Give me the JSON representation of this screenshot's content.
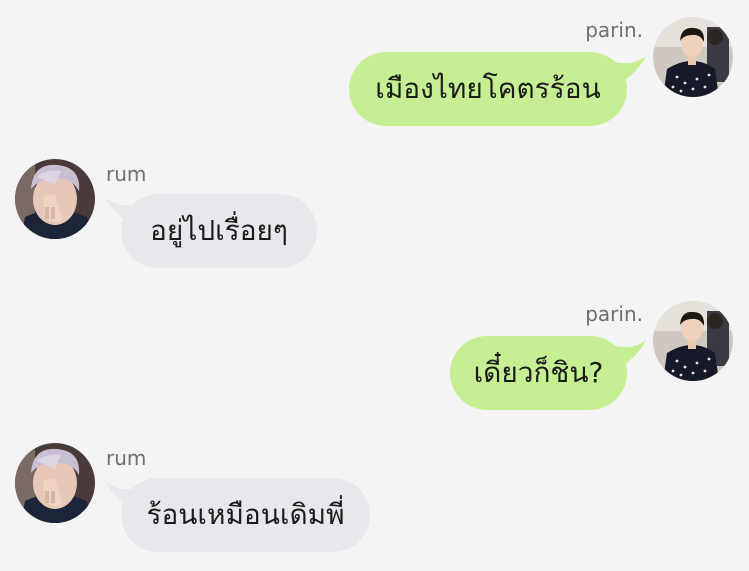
{
  "messages": [
    {
      "sender": "parin.",
      "side": "right",
      "text": "เมืองไทยโคตรร้อน"
    },
    {
      "sender": "rum",
      "side": "left",
      "text": "อยู่ไปเรื่อยๆ"
    },
    {
      "sender": "parin.",
      "side": "right",
      "text": "เดี๋ยวก็ชิน?"
    },
    {
      "sender": "rum",
      "side": "left",
      "text": "ร้อนเหมือนเดิมพี่"
    }
  ],
  "colors": {
    "background": "#f4f4f4",
    "outgoing_bubble": "#c6ee93",
    "incoming_bubble": "#e6e8eb",
    "sender_name": "#6f6f6f"
  }
}
